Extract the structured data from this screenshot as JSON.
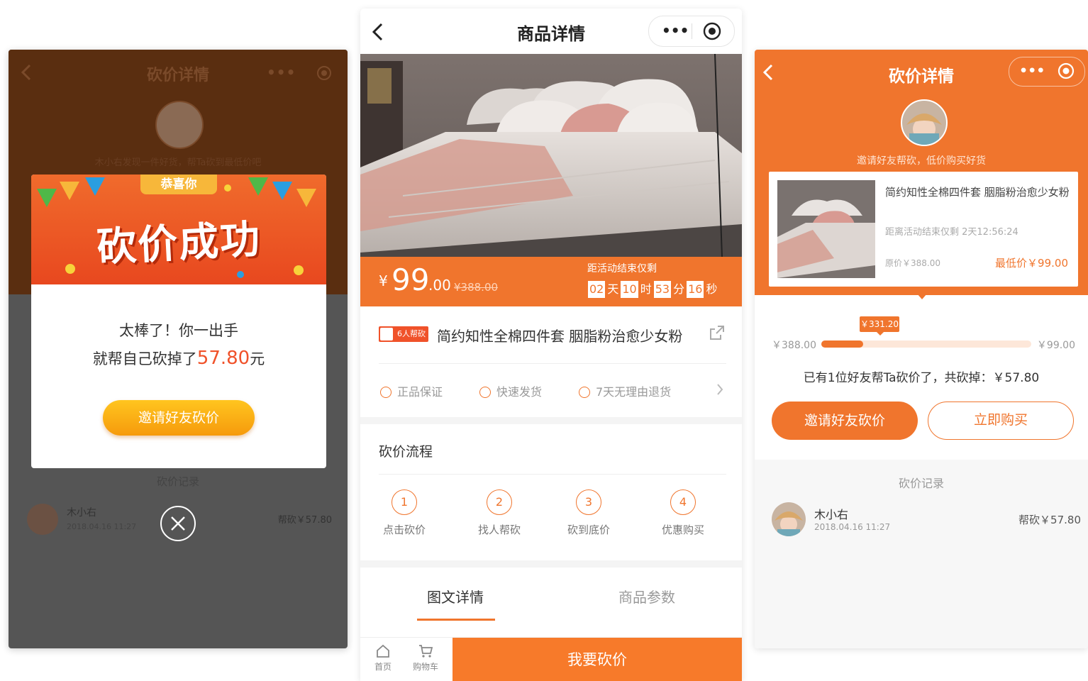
{
  "left": {
    "header_title": "砍价详情",
    "subtitle": "木小右发现一件好货，帮Ta砍到最低价吧",
    "modal": {
      "ribbon": "恭喜你",
      "headline": "砍价成功",
      "line1": "太棒了！你一出手",
      "line2_prefix": "就帮自己砍掉了",
      "amount": "57.80",
      "line2_suffix": "元",
      "invite_label": "邀请好友砍价"
    },
    "record_title": "砍价记录",
    "record": {
      "name": "木小右",
      "date": "2018.04.16  11:27",
      "amount": "帮砍￥57.80"
    }
  },
  "mid": {
    "header_title": "商品详情",
    "price": {
      "currency": "¥",
      "main": "99",
      "decimal": ".00",
      "original": "¥388.00"
    },
    "countdown": {
      "label": "距活动结束仅剩",
      "days": "02",
      "day_unit": "天",
      "hours": "10",
      "hour_unit": "时",
      "minutes": "53",
      "minute_unit": "分",
      "seconds": "16",
      "second_unit": "秒"
    },
    "helpers_tag": "6人帮砍",
    "product_name": "简约知性全棉四件套 胭脂粉治愈少女粉",
    "guarantees": [
      "正品保证",
      "快速发货",
      "7天无理由退货"
    ],
    "flow_title": "砍价流程",
    "steps": [
      {
        "num": "1",
        "label": "点击砍价"
      },
      {
        "num": "2",
        "label": "找人帮砍"
      },
      {
        "num": "3",
        "label": "砍到底价"
      },
      {
        "num": "4",
        "label": "优惠购买"
      }
    ],
    "tabs": [
      "图文详情",
      "商品参数"
    ],
    "bottom": {
      "home": "首页",
      "cart": "购物车",
      "cta": "我要砍价"
    }
  },
  "right": {
    "header_title": "砍价详情",
    "subtitle": "邀请好友帮砍，低价购买好货",
    "card": {
      "name": "简约知性全棉四件套 胭脂粉治愈少女粉",
      "time": "距离活动结束仅剩 2天12:56:24",
      "original": "原价￥388.00",
      "lowest": "最低价￥99.00"
    },
    "progress": {
      "start": "￥388.00",
      "end": "￥99.00",
      "current": "￥331.20",
      "fraction": 0.2
    },
    "helped_text": "已有1位好友帮Ta砍价了，共砍掉：￥57.80",
    "invite_label": "邀请好友砍价",
    "buy_label": "立即购买",
    "record_title": "砍价记录",
    "record": {
      "name": "木小右",
      "date": "2018.04.16  11:27",
      "amount": "帮砍￥57.80"
    }
  },
  "colors": {
    "accent": "#f0752d",
    "highlight": "#f0522a",
    "gold": "#f7b73a"
  }
}
